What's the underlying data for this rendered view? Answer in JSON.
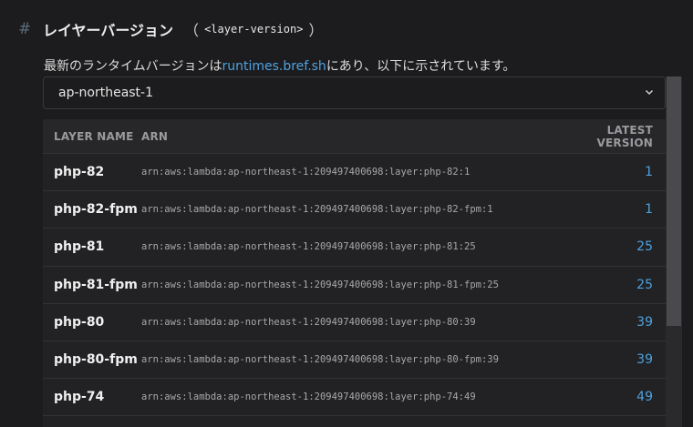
{
  "heading": {
    "hash": "#",
    "title": "レイヤーバージョン",
    "paren_open": "（",
    "code": "<layer-version>",
    "paren_close": "）"
  },
  "description": {
    "before": "最新のランタイムバージョンは",
    "link": "runtimes.bref.sh",
    "after": "にあり、以下に示されています。"
  },
  "region_select": {
    "value": "ap-northeast-1",
    "icon": "chevron-down-icon"
  },
  "table": {
    "headers": [
      "LAYER NAME",
      "ARN",
      "LATEST VERSION"
    ],
    "rows": [
      {
        "name": "php-82",
        "arn": "arn:aws:lambda:ap-northeast-1:209497400698:layer:php-82:1",
        "version": "1"
      },
      {
        "name": "php-82-fpm",
        "arn": "arn:aws:lambda:ap-northeast-1:209497400698:layer:php-82-fpm:1",
        "version": "1"
      },
      {
        "name": "php-81",
        "arn": "arn:aws:lambda:ap-northeast-1:209497400698:layer:php-81:25",
        "version": "25"
      },
      {
        "name": "php-81-fpm",
        "arn": "arn:aws:lambda:ap-northeast-1:209497400698:layer:php-81-fpm:25",
        "version": "25"
      },
      {
        "name": "php-80",
        "arn": "arn:aws:lambda:ap-northeast-1:209497400698:layer:php-80:39",
        "version": "39"
      },
      {
        "name": "php-80-fpm",
        "arn": "arn:aws:lambda:ap-northeast-1:209497400698:layer:php-80-fpm:39",
        "version": "39"
      },
      {
        "name": "php-74",
        "arn": "arn:aws:lambda:ap-northeast-1:209497400698:layer:php-74:49",
        "version": "49"
      }
    ]
  },
  "colors": {
    "accent": "#4ea1e0",
    "background": "#1c1c1e"
  }
}
